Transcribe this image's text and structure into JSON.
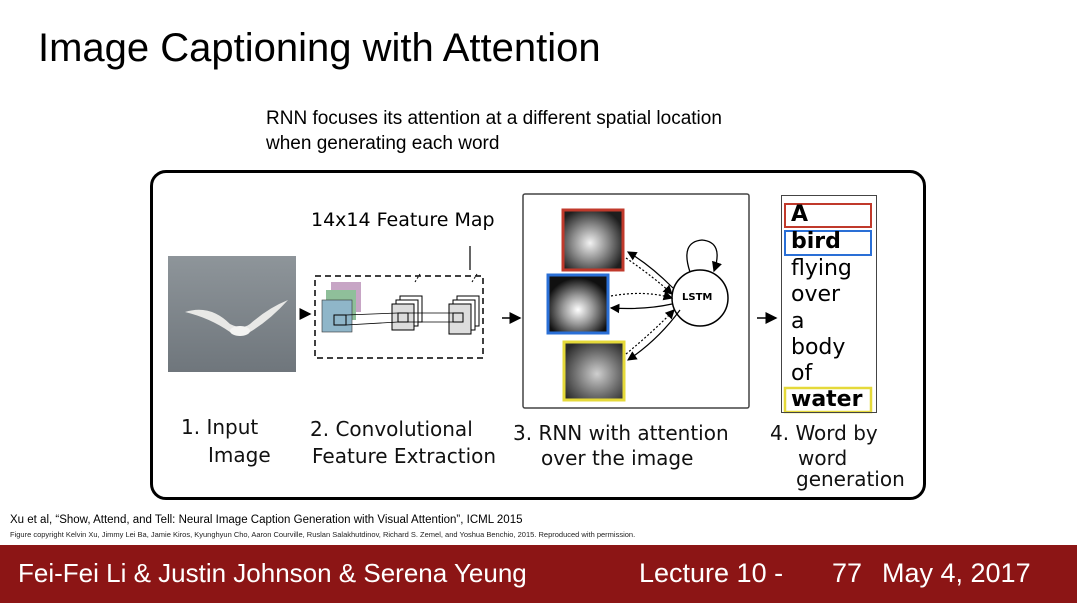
{
  "slide": {
    "title": "Image Captioning with Attention",
    "caption_line1": "RNN focuses its attention at a different spatial location",
    "caption_line2": "when generating each word"
  },
  "figure": {
    "feature_map_label": "14x14 Feature Map",
    "lstm_label": "LSTM",
    "steps": [
      {
        "line1": "1. Input",
        "line2": "Image"
      },
      {
        "line1": "2. Convolutional",
        "line2": "Feature Extraction"
      },
      {
        "line1": "3. RNN with attention",
        "line2": "over the image"
      },
      {
        "line1": "4. Word by",
        "line2": "word",
        "line3": "generation"
      }
    ],
    "words": [
      "A",
      "bird",
      "flying",
      "over",
      "a",
      "body",
      "of",
      "water"
    ],
    "attention_colors": {
      "first": "#c0392b",
      "second": "#2a6fd6",
      "third": "#e5d93a"
    }
  },
  "citation": {
    "main": "Xu et al, “Show, Attend, and Tell: Neural Image Caption Generation with Visual Attention”, ICML 2015",
    "copyright": "Figure copyright Kelvin Xu, Jimmy Lei Ba, Jamie Kiros, Kyunghyun Cho, Aaron Courville, Ruslan Salakhutdinov, Richard S. Zemel, and Yoshua Benchio, 2015. Reproduced with permission."
  },
  "footer": {
    "names": "Fei-Fei Li & Justin Johnson & Serena Yeung",
    "lecture": "Lecture 10 -",
    "page": "77",
    "date": "May 4, 2017",
    "background": "#8c1515"
  }
}
